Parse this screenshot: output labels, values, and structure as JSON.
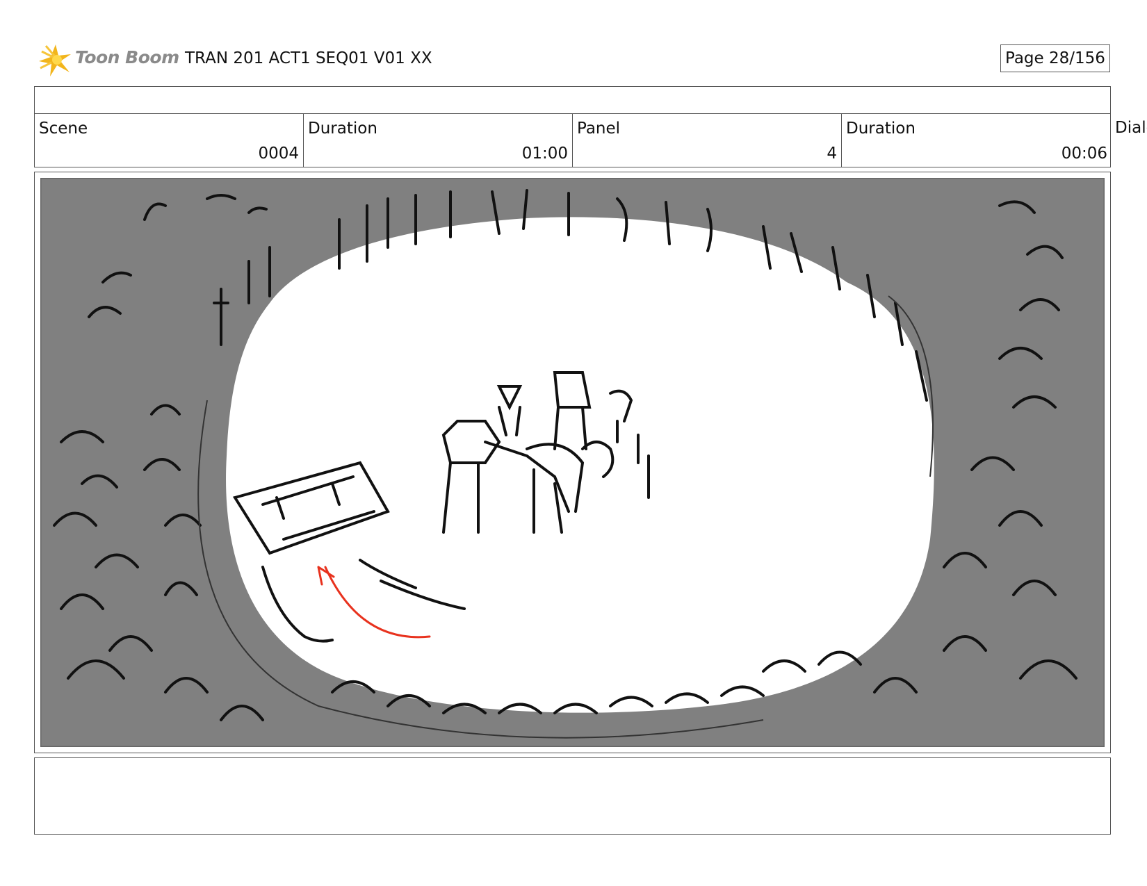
{
  "header": {
    "logo_text": "Toon Boom",
    "title": "TRAN 201 ACT1 SEQ01 V01 XX",
    "page_label": "Page  28/156"
  },
  "info": {
    "scene_label": "Scene",
    "scene_value": "0004",
    "scene_duration_label": "Duration",
    "scene_duration_value": "01:00",
    "panel_label": "Panel",
    "panel_value": "4",
    "panel_duration_label": "Duration",
    "panel_duration_value": "00:06",
    "dialog_label": "Dialo"
  },
  "panel_image": {
    "icon": "storyboard-sketch",
    "subject": "overhead crowd around arena with robots and a sliding car",
    "colors": {
      "crowd_fill": "#808080",
      "arena_floor": "#ffffff",
      "ink": "#111111",
      "motion_arrow": "#e8321e"
    }
  },
  "notes": {
    "text": ""
  },
  "colors": {
    "border": "#555555",
    "logo_accent": "#f2b51c",
    "logo_text": "#8a8a8a"
  }
}
